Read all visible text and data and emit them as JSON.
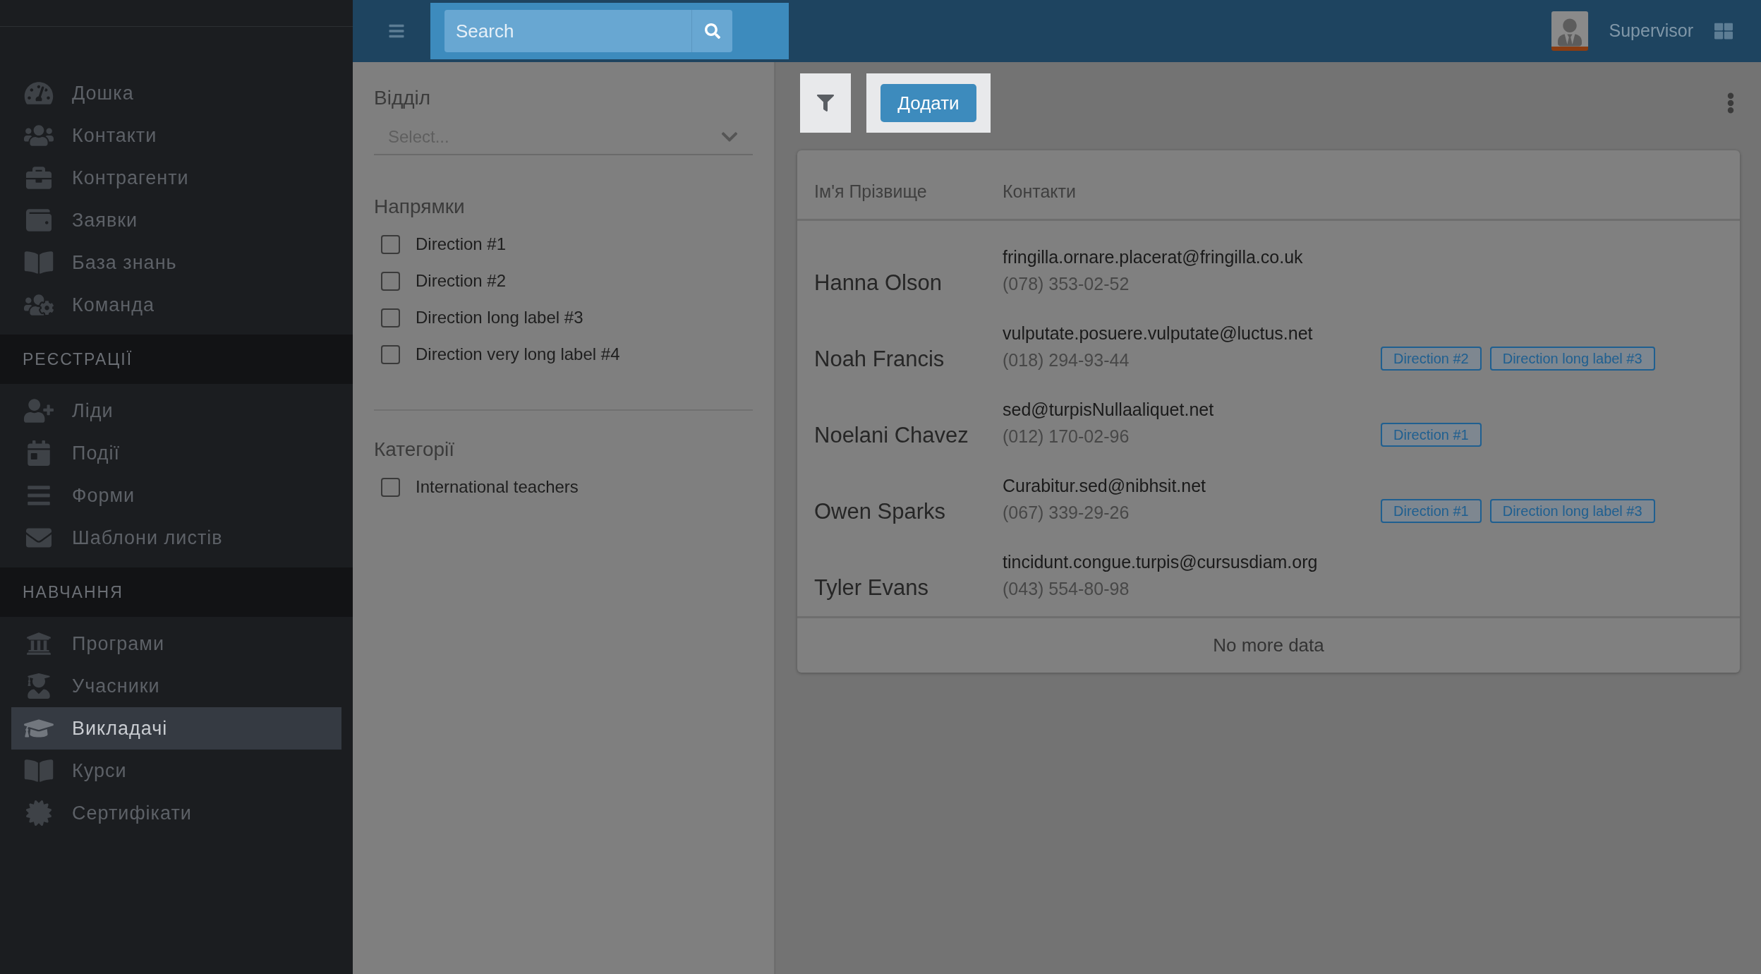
{
  "sidebar": {
    "sections": [
      {
        "items": [
          {
            "label": "Дошка",
            "selected": false
          },
          {
            "label": "Контакти",
            "selected": false
          },
          {
            "label": "Контрагенти",
            "selected": false
          },
          {
            "label": "Заявки",
            "selected": false
          },
          {
            "label": "База знань",
            "selected": false
          },
          {
            "label": "Команда",
            "selected": false
          }
        ]
      },
      {
        "title": "РЕЄСТРАЦІЇ",
        "items": [
          {
            "label": "Ліди",
            "selected": false
          },
          {
            "label": "Події",
            "selected": false
          },
          {
            "label": "Форми",
            "selected": false
          },
          {
            "label": "Шаблони листів",
            "selected": false
          }
        ]
      },
      {
        "title": "НАВЧАННЯ",
        "items": [
          {
            "label": "Програми",
            "selected": false
          },
          {
            "label": "Учасники",
            "selected": false
          },
          {
            "label": "Викладачі",
            "selected": true
          },
          {
            "label": "Курси",
            "selected": false
          },
          {
            "label": "Сертифікати",
            "selected": false
          }
        ]
      }
    ]
  },
  "topbar": {
    "search": {
      "placeholder": "Search"
    },
    "user": "Supervisor"
  },
  "filters": {
    "department": {
      "label": "Відділ",
      "placeholder": "Select..."
    },
    "directions": {
      "label": "Напрямки",
      "options": [
        {
          "label": "Direction #1",
          "checked": false
        },
        {
          "label": "Direction #2",
          "checked": false
        },
        {
          "label": "Direction long label #3",
          "checked": false
        },
        {
          "label": "Direction very long label #4",
          "checked": false
        }
      ]
    },
    "categories": {
      "label": "Категорії",
      "options": [
        {
          "label": "International teachers",
          "checked": false
        }
      ]
    }
  },
  "toolbar": {
    "add_button": "Додати"
  },
  "table": {
    "columns": [
      "Ім'я Прізвище",
      "Контакти"
    ],
    "rows": [
      {
        "name": "Hanna Olson",
        "email": "fringilla.ornare.placerat@fringilla.co.uk",
        "phone": "(078) 353-02-52",
        "tags": []
      },
      {
        "name": "Noah Francis",
        "email": "vulputate.posuere.vulputate@luctus.net",
        "phone": "(018) 294-93-44",
        "tags": [
          "Direction #2",
          "Direction long label #3"
        ]
      },
      {
        "name": "Noelani Chavez",
        "email": "sed@turpisNullaaliquet.net",
        "phone": "(012) 170-02-96",
        "tags": [
          "Direction #1"
        ]
      },
      {
        "name": "Owen Sparks",
        "email": "Curabitur.sed@nibhsit.net",
        "phone": "(067) 339-29-26",
        "tags": [
          "Direction #1",
          "Direction long label #3"
        ]
      },
      {
        "name": "Tyler Evans",
        "email": "tincidunt.congue.turpis@cursusdiam.org",
        "phone": "(043) 554-80-98",
        "tags": []
      }
    ],
    "footer": "No more data"
  }
}
